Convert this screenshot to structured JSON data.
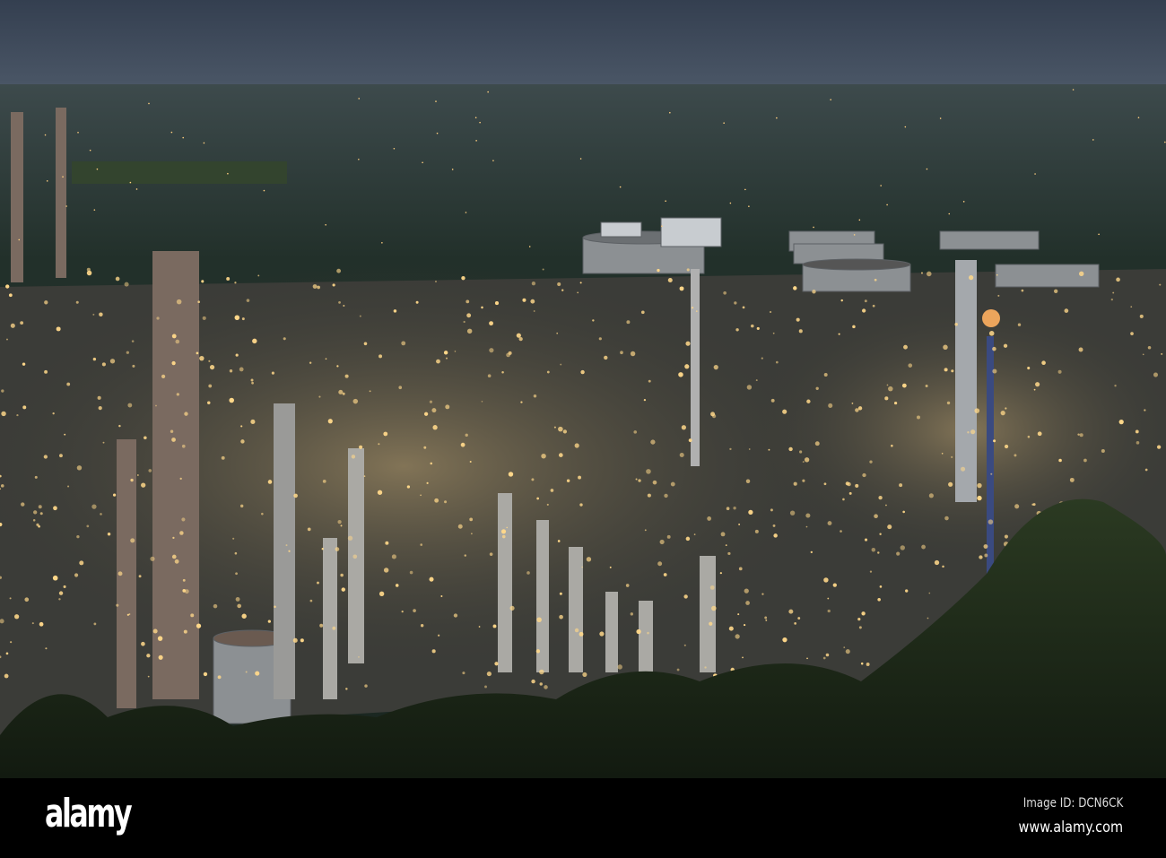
{
  "watermark": {
    "logo": "alamy",
    "image_id": "Image ID: DCN6CK",
    "url": "www.alamy.com"
  },
  "colors": {
    "sky": "#3b4657",
    "forest": "#1e2a22",
    "light": "#ffd88a",
    "footer": "#000000"
  }
}
